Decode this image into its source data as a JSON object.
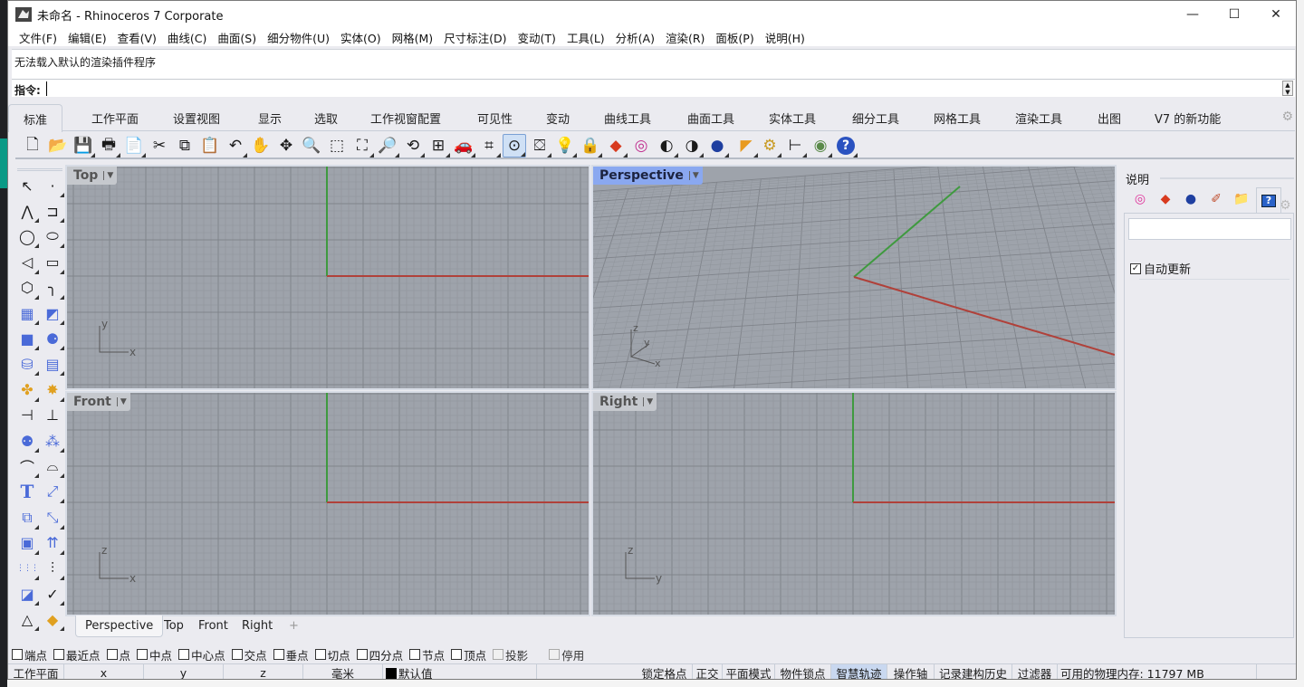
{
  "window": {
    "title": "未命名 - Rhinoceros 7 Corporate",
    "controls": {
      "minimize": "—",
      "maximize": "☐",
      "close": "✕"
    }
  },
  "menu": [
    "文件(F)",
    "编辑(E)",
    "查看(V)",
    "曲线(C)",
    "曲面(S)",
    "细分物件(U)",
    "实体(O)",
    "网格(M)",
    "尺寸标注(D)",
    "变动(T)",
    "工具(L)",
    "分析(A)",
    "渲染(R)",
    "面板(P)",
    "说明(H)"
  ],
  "command": {
    "history": "无法载入默认的渲染插件程序",
    "prompt": "指令:",
    "value": ""
  },
  "ribbon_tabs": [
    {
      "label": "标准",
      "active": true
    },
    {
      "label": "工作平面"
    },
    {
      "label": "设置视图"
    },
    {
      "label": "显示"
    },
    {
      "label": "选取"
    },
    {
      "label": "工作视窗配置"
    },
    {
      "label": "可见性"
    },
    {
      "label": "变动"
    },
    {
      "label": "曲线工具"
    },
    {
      "label": "曲面工具"
    },
    {
      "label": "实体工具"
    },
    {
      "label": "细分工具"
    },
    {
      "label": "网格工具"
    },
    {
      "label": "渲染工具"
    },
    {
      "label": "出图"
    },
    {
      "label": "V7 的新功能"
    }
  ],
  "toolbar": [
    {
      "name": "new-file-icon",
      "glyph": "🗋"
    },
    {
      "name": "open-folder-icon",
      "glyph": "📂"
    },
    {
      "name": "save-icon",
      "glyph": "💾"
    },
    {
      "name": "print-icon",
      "glyph": "🖶"
    },
    {
      "name": "import-icon",
      "glyph": "📄"
    },
    {
      "name": "cut-icon",
      "glyph": "✂"
    },
    {
      "name": "copy-icon",
      "glyph": "⧉"
    },
    {
      "name": "paste-icon",
      "glyph": "📋"
    },
    {
      "name": "undo-icon",
      "glyph": "↶"
    },
    {
      "name": "pan-hand-icon",
      "glyph": "✋"
    },
    {
      "name": "rotate-view-icon",
      "glyph": "✥"
    },
    {
      "name": "zoom-dynamic-icon",
      "glyph": "🔍"
    },
    {
      "name": "zoom-window-icon",
      "glyph": "⬚"
    },
    {
      "name": "zoom-extents-icon",
      "glyph": "⛶"
    },
    {
      "name": "zoom-selected-icon",
      "glyph": "🔎"
    },
    {
      "name": "undo-view-icon",
      "glyph": "⟲"
    },
    {
      "name": "viewport-layout-icon",
      "glyph": "⊞"
    },
    {
      "name": "named-view-car-icon",
      "glyph": "🚗"
    },
    {
      "name": "construction-plane-icon",
      "glyph": "⌗"
    },
    {
      "name": "osnap-toggle-icon",
      "glyph": "⊙",
      "selected": true
    },
    {
      "name": "select-filter-icon",
      "glyph": "⛋"
    },
    {
      "name": "light-bulb-icon",
      "glyph": "💡"
    },
    {
      "name": "lock-icon",
      "glyph": "🔒"
    },
    {
      "name": "material-icon",
      "glyph": "◆"
    },
    {
      "name": "color-wheel-icon",
      "glyph": "◎"
    },
    {
      "name": "sphere-wire-icon",
      "glyph": "◐"
    },
    {
      "name": "sphere-shaded-icon",
      "glyph": "◑"
    },
    {
      "name": "sphere-render-icon",
      "glyph": "●"
    },
    {
      "name": "render-cone-icon",
      "glyph": "◤"
    },
    {
      "name": "options-gear-icon",
      "glyph": "⚙"
    },
    {
      "name": "dimension-icon",
      "glyph": "⊢"
    },
    {
      "name": "grasshopper-icon",
      "glyph": "◉"
    },
    {
      "name": "help-icon",
      "glyph": "?"
    }
  ],
  "toolbox": [
    {
      "name": "select-arrow-icon",
      "glyph": "↖"
    },
    {
      "name": "point-icon",
      "glyph": "·"
    },
    {
      "name": "polyline-icon",
      "glyph": "⋀"
    },
    {
      "name": "curve-cv-icon",
      "glyph": "⊐"
    },
    {
      "name": "circle-icon",
      "glyph": "◯"
    },
    {
      "name": "ellipse-icon",
      "glyph": "⬭"
    },
    {
      "name": "arc-icon",
      "glyph": "◁"
    },
    {
      "name": "rectangle-icon",
      "glyph": "▭"
    },
    {
      "name": "polygon-icon",
      "glyph": "⬡"
    },
    {
      "name": "fillet-curve-icon",
      "glyph": "╮"
    },
    {
      "name": "surface-corner-icon",
      "glyph": "▦"
    },
    {
      "name": "extrude-surface-icon",
      "glyph": "◩"
    },
    {
      "name": "box-icon",
      "glyph": "■"
    },
    {
      "name": "spheres-icon",
      "glyph": "⚈"
    },
    {
      "name": "cylinder-icon",
      "glyph": "⛁"
    },
    {
      "name": "mesh-plane-icon",
      "glyph": "▤"
    },
    {
      "name": "boolean-puzzle-icon",
      "glyph": "✤"
    },
    {
      "name": "explode-icon",
      "glyph": "✸"
    },
    {
      "name": "trim-icon",
      "glyph": "⊣"
    },
    {
      "name": "split-icon",
      "glyph": "⊥"
    },
    {
      "name": "group-icon",
      "glyph": "⚉"
    },
    {
      "name": "ungroup-icon",
      "glyph": "⁂"
    },
    {
      "name": "fillet-edge-icon",
      "glyph": "⌒"
    },
    {
      "name": "offset-curve-icon",
      "glyph": "⌓"
    },
    {
      "name": "text-icon",
      "glyph": "T"
    },
    {
      "name": "scale-icon",
      "glyph": "⤢"
    },
    {
      "name": "array-icon",
      "glyph": "⧉"
    },
    {
      "name": "orient-icon",
      "glyph": "⤡"
    },
    {
      "name": "solid-edit-icon",
      "glyph": "▣"
    },
    {
      "name": "extrude-arrows-icon",
      "glyph": "⇈"
    },
    {
      "name": "grid-array-icon",
      "glyph": "⋮⋮⋮"
    },
    {
      "name": "align-icon",
      "glyph": "⫶"
    },
    {
      "name": "bend-icon",
      "glyph": "◪"
    },
    {
      "name": "check-icon",
      "glyph": "✓"
    },
    {
      "name": "shapes-icon",
      "glyph": "△"
    },
    {
      "name": "render-icon",
      "glyph": "◆"
    }
  ],
  "viewports": [
    {
      "name": "Top",
      "active": false,
      "axis_labels": [
        "y",
        "x"
      ]
    },
    {
      "name": "Perspective",
      "active": true,
      "axis_labels": [
        "z",
        "y",
        "x"
      ]
    },
    {
      "name": "Front",
      "active": false,
      "axis_labels": [
        "z",
        "x"
      ]
    },
    {
      "name": "Right",
      "active": false,
      "axis_labels": [
        "z",
        "y"
      ]
    }
  ],
  "viewport_tabs": [
    {
      "label": "Perspective",
      "active": true
    },
    {
      "label": "Top"
    },
    {
      "label": "Front"
    },
    {
      "label": "Right"
    },
    {
      "label": "+"
    }
  ],
  "panel": {
    "title": "说明",
    "tabs": [
      {
        "name": "color-wheel-icon",
        "glyph": "◎",
        "color": "#e0309a"
      },
      {
        "name": "material-icon",
        "glyph": "◆",
        "color": "#d83a1e"
      },
      {
        "name": "environment-icon",
        "glyph": "●",
        "color": "#1f3fa0"
      },
      {
        "name": "texture-brush-icon",
        "glyph": "✐",
        "color": "#c05030"
      },
      {
        "name": "folder-icon",
        "glyph": "📁",
        "color": "#e3b730"
      },
      {
        "name": "help-panel-icon",
        "glyph": "?",
        "color": "#2a62c8",
        "active": true
      }
    ],
    "input_value": "",
    "auto_update_label": "自动更新",
    "auto_update_checked": true
  },
  "osnaps": [
    {
      "label": "端点",
      "checked": false
    },
    {
      "label": "最近点",
      "checked": false
    },
    {
      "label": "点",
      "checked": false
    },
    {
      "label": "中点",
      "checked": false
    },
    {
      "label": "中心点",
      "checked": false
    },
    {
      "label": "交点",
      "checked": false
    },
    {
      "label": "垂点",
      "checked": false
    },
    {
      "label": "切点",
      "checked": false
    },
    {
      "label": "四分点",
      "checked": false
    },
    {
      "label": "节点",
      "checked": false
    },
    {
      "label": "顶点",
      "checked": false
    },
    {
      "label": "投影",
      "checked": false,
      "disabled": true
    },
    {
      "label": "停用",
      "checked": false,
      "disabled": true
    }
  ],
  "status": {
    "cplane": "工作平面",
    "x": "x",
    "y": "y",
    "z": "z",
    "units": "毫米",
    "layer": "默认值",
    "layer_color": "#000000",
    "toggles": [
      {
        "label": "锁定格点",
        "on": false
      },
      {
        "label": "正交",
        "on": false
      },
      {
        "label": "平面模式",
        "on": false
      },
      {
        "label": "物件锁点",
        "on": false
      },
      {
        "label": "智慧轨迹",
        "on": true
      },
      {
        "label": "操作轴",
        "on": false
      },
      {
        "label": "记录建构历史",
        "on": false
      },
      {
        "label": "过滤器",
        "on": false
      }
    ],
    "memory": "可用的物理内存: 11797 MB"
  },
  "colors": {
    "viewport_bg": "#9ea3ab",
    "x_axis": "#b0413a",
    "y_axis": "#3f9a3f",
    "active_viewport_label": "#8aa8f0",
    "highlight": "#c9d8f0"
  }
}
